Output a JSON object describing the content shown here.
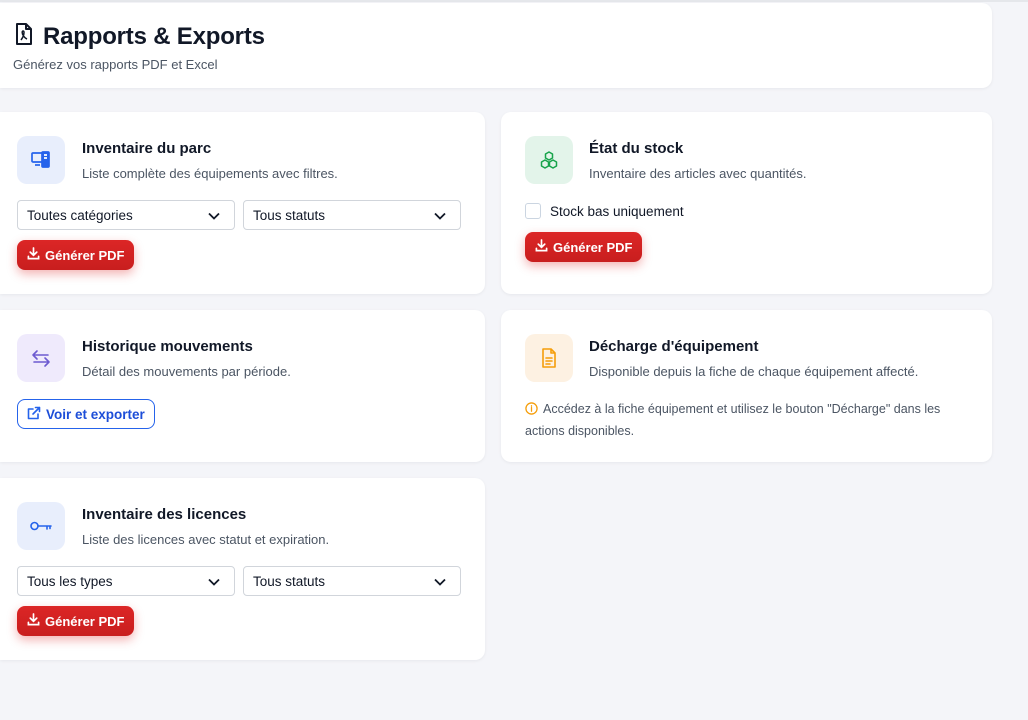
{
  "header": {
    "title": "Rapports & Exports",
    "subtitle": "Générez vos rapports PDF et Excel"
  },
  "cards": {
    "inventaire": {
      "title": "Inventaire du parc",
      "description": "Liste complète des équipements avec filtres.",
      "filter_category": "Toutes catégories",
      "filter_status": "Tous statuts",
      "button": "Générer PDF"
    },
    "stock": {
      "title": "État du stock",
      "description": "Inventaire des articles avec quantités.",
      "checkbox_label": "Stock bas uniquement",
      "button": "Générer PDF"
    },
    "historique": {
      "title": "Historique mouvements",
      "description": "Détail des mouvements par période.",
      "button": "Voir et exporter"
    },
    "decharge": {
      "title": "Décharge d'équipement",
      "description": "Disponible depuis la fiche de chaque équipement affecté.",
      "note": "Accédez à la fiche équipement et utilisez le bouton \"Décharge\" dans les actions disponibles."
    },
    "licences": {
      "title": "Inventaire des licences",
      "description": "Liste des licences avec statut et expiration.",
      "filter_type": "Tous les types",
      "filter_status": "Tous statuts",
      "button": "Générer PDF"
    }
  },
  "icons": {
    "header": "pdf-file-icon",
    "inventaire": "devices-icon",
    "stock": "boxes-icon",
    "historique": "arrows-exchange-icon",
    "decharge": "document-icon",
    "licences": "key-icon"
  },
  "colors": {
    "primary_red": "#dc2626",
    "accent_blue": "#2563eb",
    "tile_blue": "#e8eefc",
    "tile_green": "#e3f4ea",
    "tile_purple": "#efeafc",
    "tile_orange": "#fdf1e2",
    "info_orange": "#f59e0b"
  }
}
